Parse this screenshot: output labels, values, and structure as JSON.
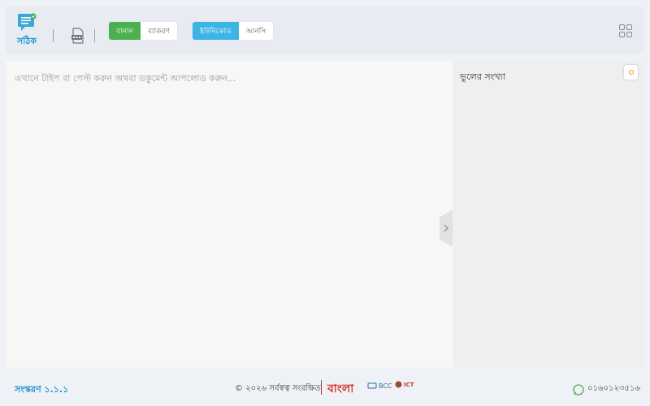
{
  "header": {
    "logo_label": "সঠিক",
    "mode_group": [
      "বানান",
      "ব্যাকরণ"
    ],
    "encoding_group": [
      "ইউনিকোড",
      "আনসি"
    ]
  },
  "editor": {
    "placeholder": "এখানে টাইপ বা পেস্ট করুন অথবা ডকুমেন্ট আপলোড করুন..."
  },
  "side": {
    "title": "ভুলের সংখ্যা"
  },
  "footer": {
    "version": "সংস্করণ ১.১.১",
    "copyright": "© ২০২৬ সর্বস্বত্ব সংরক্ষিত",
    "bangla_logo": "বাংলা",
    "bcc": "BCC",
    "ict": "ICT",
    "phone": "০১৬০১২৩৫১৬"
  },
  "colors": {
    "accent_blue": "#2196c9",
    "active_green": "#4caf50",
    "active_blue": "#3cb4e6",
    "badge_orange": "#f39c12"
  }
}
